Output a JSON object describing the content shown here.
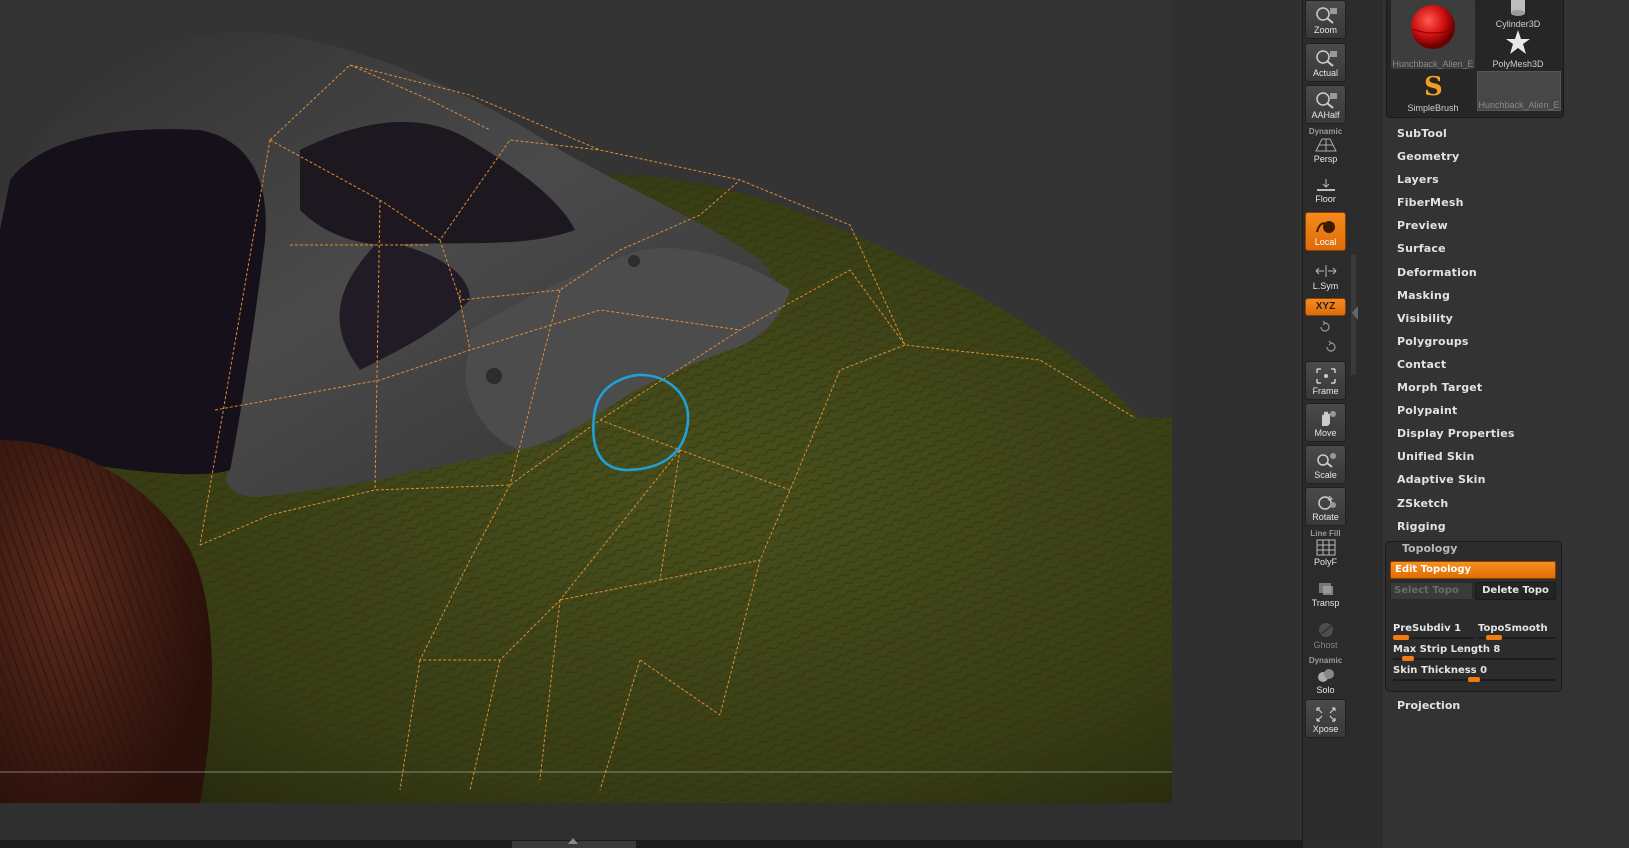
{
  "viewport": {
    "ring_color": "#1fa0d6",
    "topology_wire_color": "#e7913a",
    "skin_color": "#3d4218",
    "helmet_color": "#3f3f3f"
  },
  "shelf": {
    "buttons": [
      {
        "id": "zoom",
        "label": "Zoom",
        "icon": "zoom-icon",
        "active": false
      },
      {
        "id": "actual",
        "label": "Actual",
        "icon": "actual-icon",
        "active": false
      },
      {
        "id": "aahalf",
        "label": "AAHalf",
        "icon": "aahalf-icon",
        "active": false
      },
      {
        "id": "persp",
        "label": "Persp",
        "caption": "Dynamic",
        "icon": "persp-icon",
        "active": false
      },
      {
        "id": "floor",
        "label": "Floor",
        "icon": "floor-icon",
        "active": false
      },
      {
        "id": "local",
        "label": "Local",
        "icon": "local-icon",
        "active": true
      },
      {
        "id": "lsym",
        "label": "L.Sym",
        "icon": "lsym-icon",
        "active": false
      },
      {
        "id": "frame",
        "label": "Frame",
        "icon": "frame-icon",
        "active": false
      },
      {
        "id": "move",
        "label": "Move",
        "icon": "move-icon",
        "active": false
      },
      {
        "id": "scale",
        "label": "Scale",
        "icon": "scale-icon",
        "active": false
      },
      {
        "id": "rotate",
        "label": "Rotate",
        "icon": "rotate-icon",
        "active": false
      },
      {
        "id": "polyf",
        "label": "PolyF",
        "caption": "Line Fill",
        "icon": "polyf-icon",
        "active": false
      },
      {
        "id": "transp",
        "label": "Transp",
        "icon": "transp-icon",
        "active": false
      },
      {
        "id": "ghost",
        "label": "Ghost",
        "icon": "ghost-icon",
        "active": false
      },
      {
        "id": "solo",
        "label": "Solo",
        "caption": "Dynamic",
        "icon": "solo-icon",
        "active": false
      },
      {
        "id": "xpose",
        "label": "Xpose",
        "icon": "xpose-icon",
        "active": false
      }
    ],
    "xyz_label": "XYZ",
    "accent": "#f0820f"
  },
  "tool_thumbs": [
    {
      "label": "Hunchback_Alien_E",
      "icon": "red-sphere-icon"
    },
    {
      "label": "Cylinder3D",
      "icon": "cylinder-icon"
    },
    {
      "label": "PolyMesh3D",
      "icon": "star-icon"
    },
    {
      "label": "SimpleBrush",
      "icon": "simplebrush-s-icon"
    },
    {
      "label": "Hunchback_Alien_E",
      "icon": "grey-thumb-icon"
    }
  ],
  "menu": [
    "SubTool",
    "Geometry",
    "Layers",
    "FiberMesh",
    "Preview",
    "Surface",
    "Deformation",
    "Masking",
    "Visibility",
    "Polygroups",
    "Contact",
    "Morph Target",
    "Polypaint",
    "Display Properties",
    "Unified Skin",
    "Adaptive Skin",
    "ZSketch",
    "Rigging"
  ],
  "topology": {
    "title": "Topology",
    "edit_topology": "Edit Topology",
    "select_topo": "Select Topo",
    "delete_topo": "Delete Topo",
    "presubdiv": {
      "label": "PreSubdiv 1",
      "value": 1
    },
    "toposmooth": {
      "label": "TopoSmooth"
    },
    "max_strip": {
      "label": "Max Strip Length 8",
      "value": 8
    },
    "skin_thickness": {
      "label": "Skin Thickness 0",
      "value": 0
    }
  },
  "projection": "Projection"
}
